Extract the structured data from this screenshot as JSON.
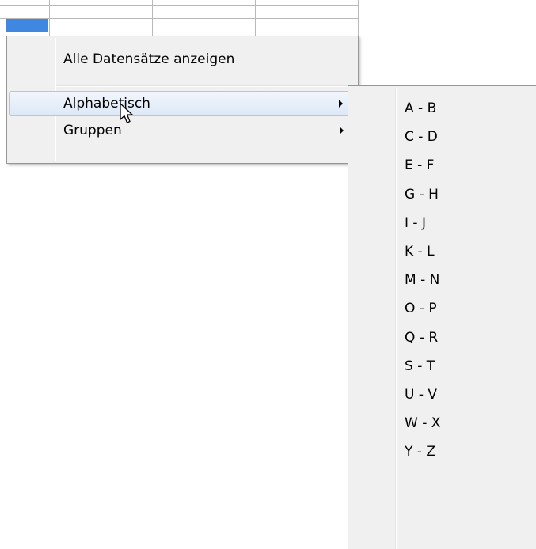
{
  "context_menu": {
    "items": [
      {
        "label": "Alle Datensätze anzeigen",
        "has_submenu": false,
        "highlighted": false
      },
      {
        "label": "Alphabetisch",
        "has_submenu": true,
        "highlighted": true
      },
      {
        "label": "Gruppen",
        "has_submenu": true,
        "highlighted": false
      }
    ]
  },
  "submenu": {
    "items": [
      "A - B",
      "C - D",
      "E - F",
      "G - H",
      "I - J",
      "K - L",
      "M - N",
      "O - P",
      "Q - R",
      "S - T",
      "U - V",
      "W - X",
      "Y - Z"
    ]
  },
  "colors": {
    "selection_cell": "#3f87e0",
    "menu_background": "#f0f0f0",
    "hover_border": "#a8c8ee"
  },
  "icons": {
    "pointer": "mouse-pointer-icon",
    "submenu_arrow": "submenu-arrow-icon"
  }
}
